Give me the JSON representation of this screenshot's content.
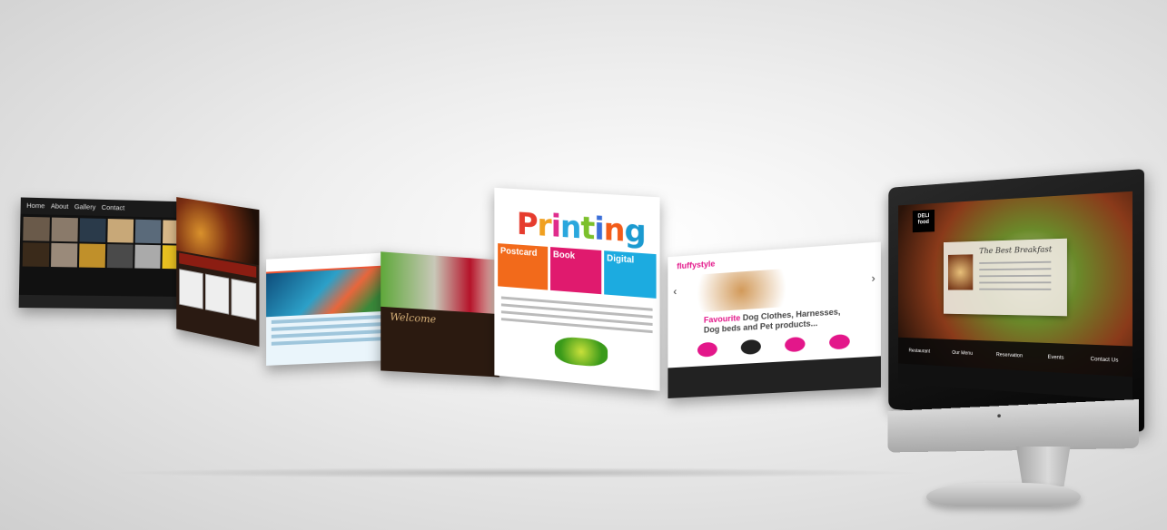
{
  "panels": {
    "photo_site": {
      "nav": [
        "Home",
        "About",
        "Gallery",
        "Contact"
      ]
    },
    "printing_site": {
      "title_letters": [
        "P",
        "r",
        "i",
        "n",
        "t",
        "i",
        "n",
        "g"
      ],
      "cards": [
        "Postcard",
        "Book",
        "Digital"
      ]
    },
    "dog_site": {
      "logo": "fluffystyle",
      "headline_pink": "Favourite",
      "headline_rest": "Dog Clothes, Harnesses,",
      "headline_line2": "Dog beds and Pet products..."
    },
    "cafe_site": {
      "script": "Welcome"
    }
  },
  "imac": {
    "logo": "DELI food",
    "card_title": "The Best Breakfast",
    "nav": [
      "Restaurant",
      "Our Menu",
      "Reservation",
      "Events",
      "Contact Us"
    ]
  },
  "colors": {
    "background": "#e6e6e6",
    "printing_orange": "#f26a1b",
    "printing_pink": "#e01a6e",
    "printing_blue": "#1cabe0",
    "dog_pink": "#e3178a"
  }
}
